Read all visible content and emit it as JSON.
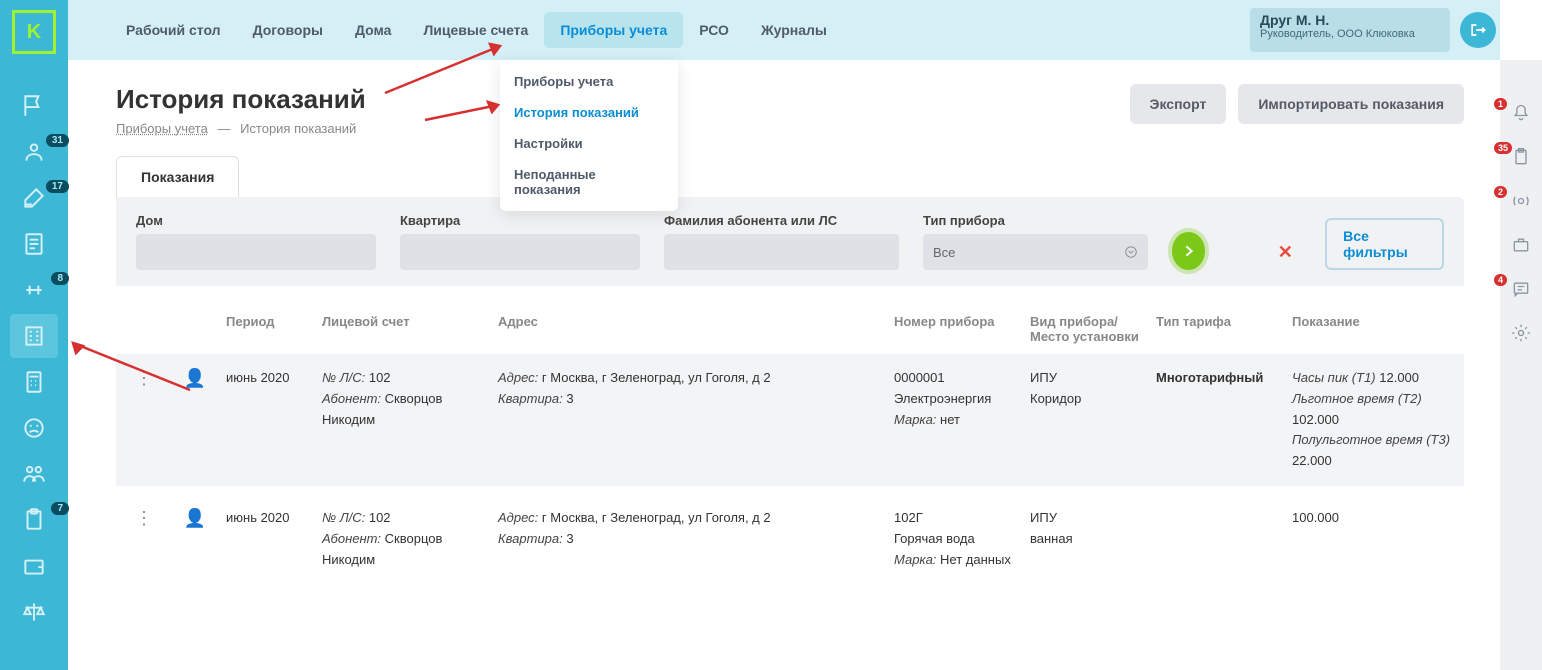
{
  "user": {
    "name": "Друг М. Н.",
    "role": "Руководитель, ООО Клюковка"
  },
  "nav": {
    "items": [
      {
        "label": "Рабочий стол"
      },
      {
        "label": "Договоры"
      },
      {
        "label": "Дома"
      },
      {
        "label": "Лицевые счета"
      },
      {
        "label": "Приборы учета",
        "active": true
      },
      {
        "label": "РСО"
      },
      {
        "label": "Журналы"
      }
    ]
  },
  "dropdown": {
    "items": [
      {
        "label": "Приборы учета"
      },
      {
        "label": "История показаний",
        "active": true
      },
      {
        "label": "Настройки"
      },
      {
        "label": "Неподанные показания"
      }
    ]
  },
  "page": {
    "title": "История показаний",
    "breadcrumb": {
      "link": "Приборы учета",
      "sep": "—",
      "current": "История показаний"
    }
  },
  "actions": {
    "export": "Экспорт",
    "import": "Импортировать показания"
  },
  "tabs": {
    "readings": "Показания"
  },
  "filters": {
    "house_label": "Дом",
    "apartment_label": "Квартира",
    "subscriber_label": "Фамилия абонента или ЛС",
    "device_type_label": "Тип прибора",
    "device_type_value": "Все",
    "all_filters": "Все фильтры"
  },
  "table": {
    "headers": {
      "period": "Период",
      "account": "Лицевой счет",
      "address": "Адрес",
      "device_number": "Номер прибора",
      "device_type": "Вид прибора/ Место установки",
      "tariff": "Тип тарифа",
      "reading": "Показание"
    },
    "rows": [
      {
        "period": "июнь 2020",
        "account_label": "№ Л/С:",
        "account_value": "102",
        "subscriber_label": "Абонент:",
        "subscriber_value": "Скворцов Никодим",
        "address_label": "Адрес:",
        "address_value": "г Москва, г Зеленоград, ул Гоголя, д 2",
        "apartment_label": "Квартира:",
        "apartment_value": "3",
        "device_number": "0000001",
        "resource": "Электроэнергия",
        "brand_label": "Марка:",
        "brand_value": "нет",
        "device_kind": "ИПУ",
        "location": "Коридор",
        "tariff": "Многотарифный",
        "reading_lines": [
          {
            "label": "Часы пик (Т1)",
            "value": "12.000"
          },
          {
            "label": "Льготное время (Т2)",
            "value": "102.000"
          },
          {
            "label": "Полульготное время (Т3)",
            "value": "22.000"
          }
        ]
      },
      {
        "period": "июнь 2020",
        "account_label": "№ Л/С:",
        "account_value": "102",
        "subscriber_label": "Абонент:",
        "subscriber_value": "Скворцов Никодим",
        "address_label": "Адрес:",
        "address_value": "г Москва, г Зеленоград, ул Гоголя, д 2",
        "apartment_label": "Квартира:",
        "apartment_value": "3",
        "device_number": "102Г",
        "resource": "Горячая вода",
        "brand_label": "Марка:",
        "brand_value": "Нет данных",
        "device_kind": "ИПУ",
        "location": "ванная",
        "tariff": "",
        "reading_single": "100.000"
      }
    ]
  },
  "left_badges": {
    "b1": "31",
    "b2": "17",
    "b3": "8",
    "b4": "7"
  },
  "right_badges": {
    "r1": "1",
    "r2": "35",
    "r3": "2",
    "r4": "4"
  }
}
